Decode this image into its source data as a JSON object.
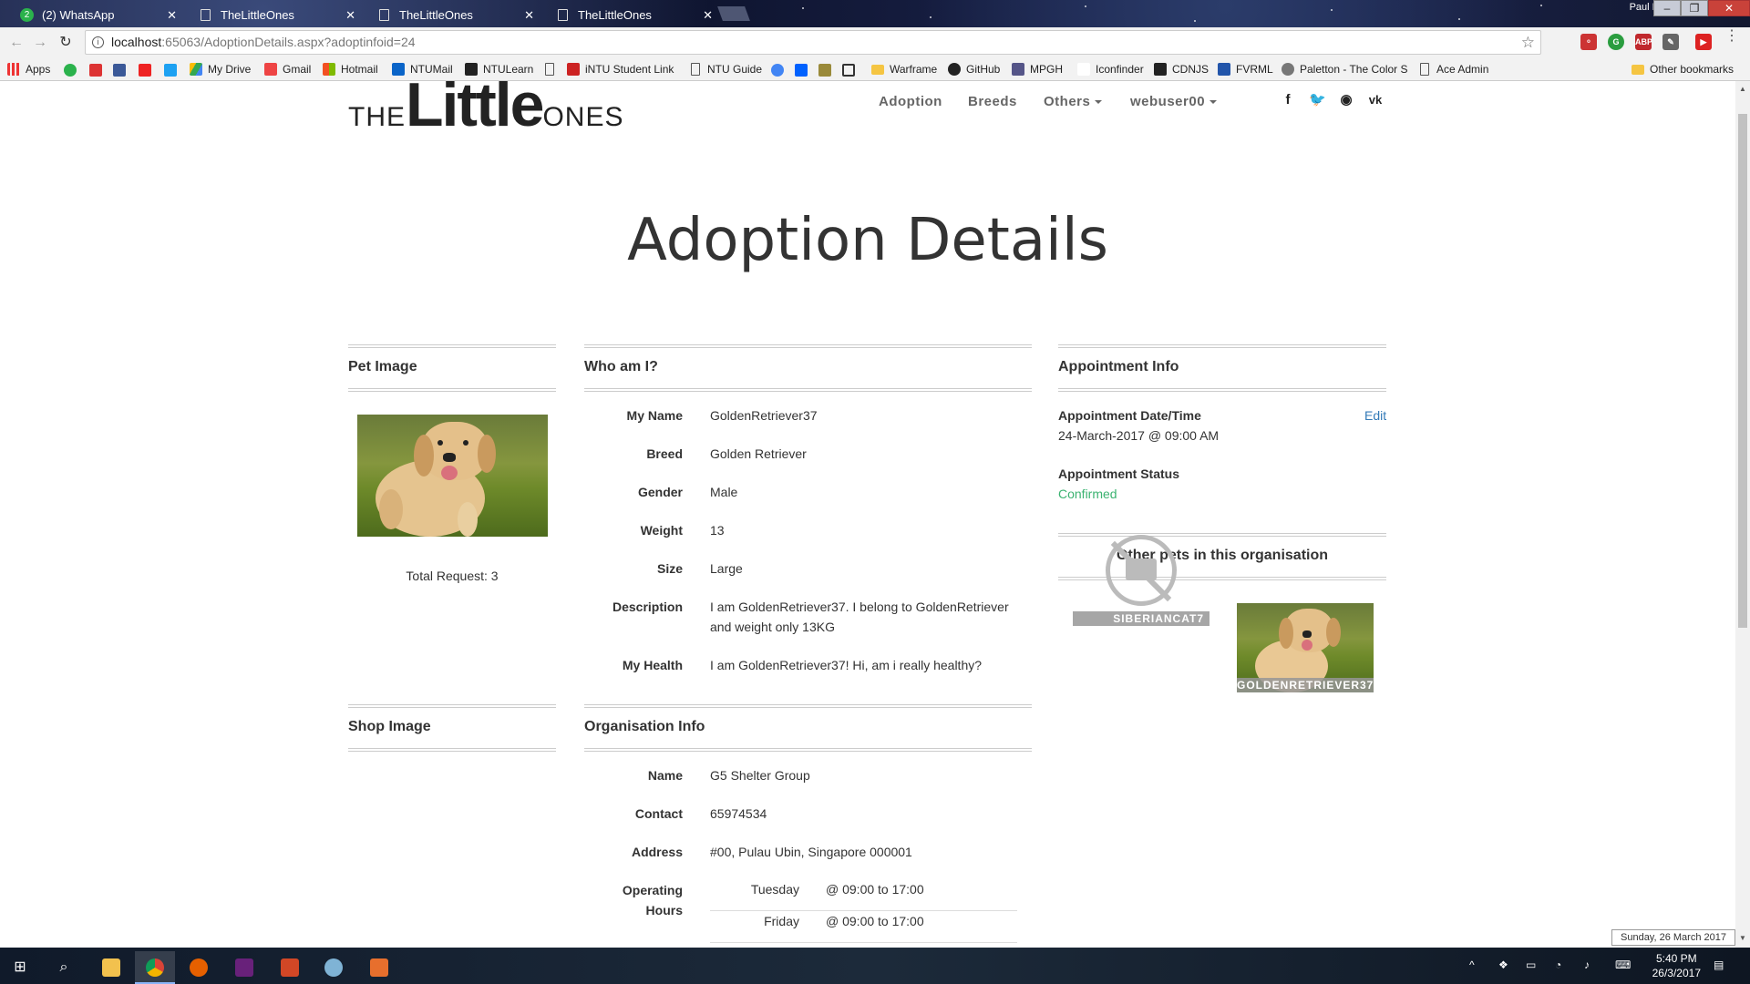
{
  "browser": {
    "tabs": [
      {
        "title": "(2) WhatsApp",
        "badge": "2"
      },
      {
        "title": "TheLittleOnes"
      },
      {
        "title": "TheLittleOnes"
      },
      {
        "title": "TheLittleOnes"
      }
    ],
    "profile": "Paul K",
    "url_host": "localhost",
    "url_path": ":65063/AdoptionDetails.aspx?adoptinfoid=24",
    "bookmarks": [
      "Apps",
      "My Drive",
      "Gmail",
      "Hotmail",
      "NTUMail",
      "NTULearn",
      "iNTU Student Link",
      "NTU Guide",
      "Warframe",
      "GitHub",
      "MPGH",
      "Iconfinder",
      "CDNJS",
      "FVRML",
      "Paletton - The Color S",
      "Ace Admin"
    ],
    "other_bookmarks": "Other bookmarks"
  },
  "site": {
    "logo": {
      "the": "THE",
      "little": "Little",
      "ones": "ONES"
    },
    "nav": {
      "adoption": "Adoption",
      "breeds": "Breeds",
      "others": "Others",
      "user": "webuser00"
    },
    "social_icons": [
      "facebook-icon",
      "twitter-icon",
      "rss-icon",
      "vk-icon"
    ]
  },
  "page": {
    "title": "Adoption Details",
    "pet_image": {
      "heading": "Pet Image",
      "total_request": "Total Request: 3"
    },
    "who_am_i": {
      "heading": "Who am I?",
      "rows": [
        {
          "label": "My Name",
          "value": "GoldenRetriever37"
        },
        {
          "label": "Breed",
          "value": "Golden Retriever"
        },
        {
          "label": "Gender",
          "value": "Male"
        },
        {
          "label": "Weight",
          "value": "13"
        },
        {
          "label": "Size",
          "value": "Large"
        },
        {
          "label": "Description",
          "value": "I am GoldenRetriever37. I belong to GoldenRetriever and weight only 13KG"
        },
        {
          "label": "My Health",
          "value": "I am GoldenRetriever37! Hi, am i really healthy?"
        }
      ]
    },
    "appointment": {
      "heading": "Appointment Info",
      "datetime_label": "Appointment Date/Time",
      "datetime_value": "24-March-2017 @ 09:00 AM",
      "edit": "Edit",
      "status_label": "Appointment Status",
      "status_value": "Confirmed",
      "status_color": "#3cb371"
    },
    "other_pets": {
      "heading": "Other pets in this organisation",
      "pets": [
        {
          "name": "SIBERIANCAT7",
          "image": "no-image-icon"
        },
        {
          "name": "GOLDENRETRIEVER37",
          "image": "golden-retriever-photo"
        }
      ]
    },
    "shop_image": {
      "heading": "Shop Image"
    },
    "organisation": {
      "heading": "Organisation Info",
      "name_label": "Name",
      "name_value": "G5 Shelter Group",
      "contact_label": "Contact",
      "contact_value": "65974534",
      "address_label": "Address",
      "address_value": "#00, Pulau Ubin, Singapore 000001",
      "hours_label_1": "Operating",
      "hours_label_2": "Hours",
      "hours": [
        {
          "day": "Tuesday",
          "time": "@ 09:00 to 17:00"
        },
        {
          "day": "Friday",
          "time": "@ 09:00 to 17:00"
        }
      ]
    }
  },
  "taskbar": {
    "time": "5:40 PM",
    "date": "26/3/2017",
    "date_tooltip": "Sunday, 26 March 2017"
  },
  "colors": {
    "link": "#337ab7",
    "confirmed": "#3cb371"
  }
}
